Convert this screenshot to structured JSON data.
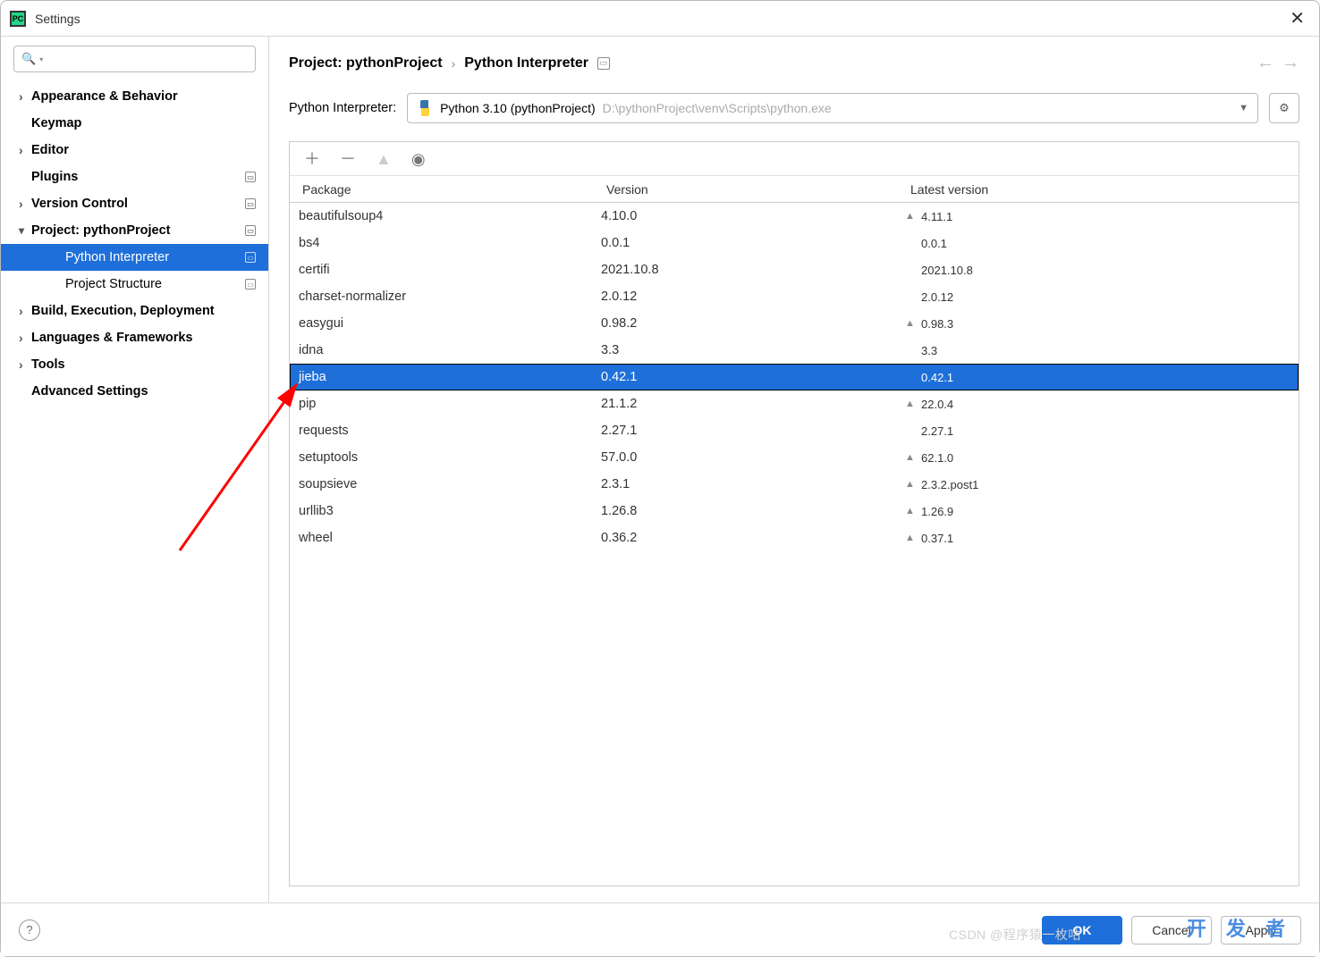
{
  "window": {
    "title": "Settings"
  },
  "sidebar": {
    "items": [
      {
        "label": "Appearance & Behavior",
        "bold": true,
        "chev": "right",
        "indent": 0
      },
      {
        "label": "Keymap",
        "bold": true,
        "chev": "none",
        "indent": 0
      },
      {
        "label": "Editor",
        "bold": true,
        "chev": "right",
        "indent": 0
      },
      {
        "label": "Plugins",
        "bold": true,
        "chev": "none",
        "indent": 0,
        "badge": true
      },
      {
        "label": "Version Control",
        "bold": true,
        "chev": "right",
        "indent": 0,
        "badge": true
      },
      {
        "label": "Project: pythonProject",
        "bold": true,
        "chev": "down",
        "indent": 0,
        "badge": true
      },
      {
        "label": "Python Interpreter",
        "bold": false,
        "chev": "none",
        "indent": 1,
        "badge": true,
        "selected": true
      },
      {
        "label": "Project Structure",
        "bold": false,
        "chev": "none",
        "indent": 1,
        "badge": true
      },
      {
        "label": "Build, Execution, Deployment",
        "bold": true,
        "chev": "right",
        "indent": 0
      },
      {
        "label": "Languages & Frameworks",
        "bold": true,
        "chev": "right",
        "indent": 0
      },
      {
        "label": "Tools",
        "bold": true,
        "chev": "right",
        "indent": 0
      },
      {
        "label": "Advanced Settings",
        "bold": true,
        "chev": "none",
        "indent": 0
      }
    ]
  },
  "breadcrumb": {
    "item1": "Project: pythonProject",
    "item2": "Python Interpreter"
  },
  "interpreter": {
    "label": "Python Interpreter:",
    "name": "Python 3.10 (pythonProject)",
    "path": "D:\\pythonProject\\venv\\Scripts\\python.exe"
  },
  "packages": {
    "headers": {
      "pkg": "Package",
      "ver": "Version",
      "lat": "Latest version"
    },
    "rows": [
      {
        "name": "beautifulsoup4",
        "ver": "4.10.0",
        "lat": "4.11.1",
        "upgrade": true
      },
      {
        "name": "bs4",
        "ver": "0.0.1",
        "lat": "0.0.1",
        "upgrade": false
      },
      {
        "name": "certifi",
        "ver": "2021.10.8",
        "lat": "2021.10.8",
        "upgrade": false
      },
      {
        "name": "charset-normalizer",
        "ver": "2.0.12",
        "lat": "2.0.12",
        "upgrade": false
      },
      {
        "name": "easygui",
        "ver": "0.98.2",
        "lat": "0.98.3",
        "upgrade": true
      },
      {
        "name": "idna",
        "ver": "3.3",
        "lat": "3.3",
        "upgrade": false
      },
      {
        "name": "jieba",
        "ver": "0.42.1",
        "lat": "0.42.1",
        "upgrade": false,
        "selected": true
      },
      {
        "name": "pip",
        "ver": "21.1.2",
        "lat": "22.0.4",
        "upgrade": true
      },
      {
        "name": "requests",
        "ver": "2.27.1",
        "lat": "2.27.1",
        "upgrade": false
      },
      {
        "name": "setuptools",
        "ver": "57.0.0",
        "lat": "62.1.0",
        "upgrade": true
      },
      {
        "name": "soupsieve",
        "ver": "2.3.1",
        "lat": "2.3.2.post1",
        "upgrade": true
      },
      {
        "name": "urllib3",
        "ver": "1.26.8",
        "lat": "1.26.9",
        "upgrade": true
      },
      {
        "name": "wheel",
        "ver": "0.36.2",
        "lat": "0.37.1",
        "upgrade": true
      }
    ]
  },
  "footer": {
    "ok": "OK",
    "cancel": "Cancel",
    "apply": "Apply"
  },
  "watermarks": {
    "csdn": "CSDN @程序猿一枚咕",
    "devze": "开 发 者"
  }
}
